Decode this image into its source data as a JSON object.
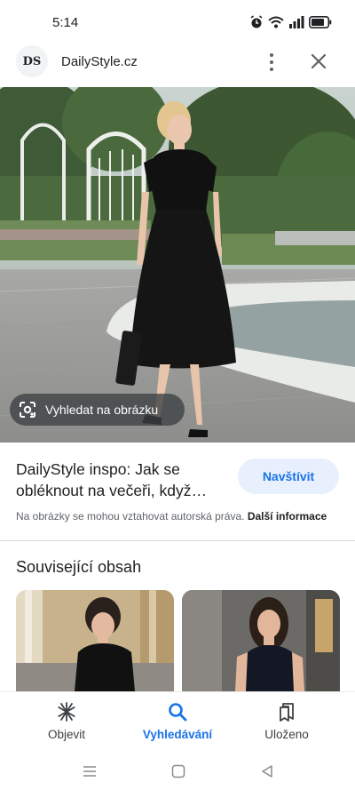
{
  "status_bar": {
    "time": "5:14",
    "icons": [
      "alarm-icon",
      "wifi-icon",
      "signal-icon",
      "battery-icon"
    ]
  },
  "header": {
    "favicon_text": "DS",
    "site_name": "DailyStyle.cz",
    "more_icon": "more-vert-icon",
    "close_icon": "close-icon"
  },
  "image": {
    "lens_label": "Vyhledat na obrázku",
    "lens_icon": "google-lens-icon"
  },
  "result": {
    "title": "DailyStyle inspo: Jak se obléknout na večeři, když…",
    "visit_label": "Navštívit",
    "copyright_text": "Na obrázky se mohou vztahovat autorská práva.",
    "more_info_link": "Další informace"
  },
  "related": {
    "heading": "Související obsah"
  },
  "bottom_nav": {
    "items": [
      {
        "label": "Objevit",
        "icon": "asterisk-icon",
        "active": false
      },
      {
        "label": "Vyhledávání",
        "icon": "search-icon",
        "active": true
      },
      {
        "label": "Uloženo",
        "icon": "collections-icon",
        "active": false
      }
    ]
  },
  "system_nav": [
    "recents-icon",
    "home-icon",
    "back-icon"
  ],
  "colors": {
    "accent": "#1a73e8",
    "visit_bg": "#e8f0fe",
    "text_primary": "#202124",
    "text_secondary": "#5f6368"
  }
}
